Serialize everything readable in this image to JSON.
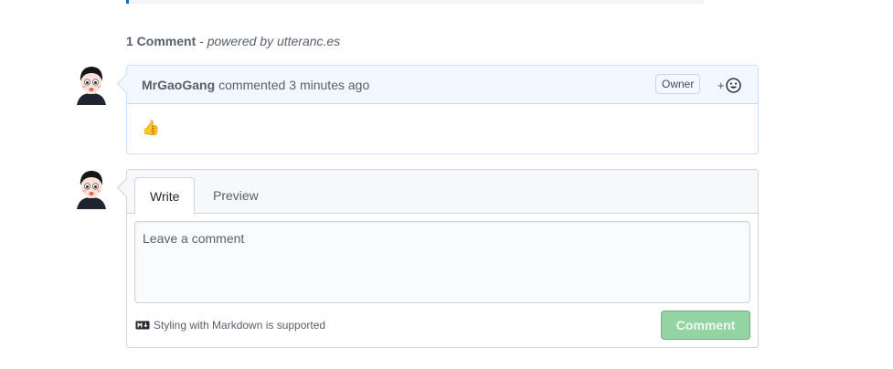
{
  "header": {
    "comment_count": "1 Comment",
    "separator": " - ",
    "powered_by": "powered by utteranc.es"
  },
  "comment": {
    "author": "MrGaoGang",
    "action": "commented",
    "time": "3 minutes ago",
    "badge": "Owner",
    "reaction_plus": "+",
    "reaction_icon": "smiley-icon",
    "body": "👍"
  },
  "editor": {
    "tabs": [
      {
        "label": "Write",
        "active": true
      },
      {
        "label": "Preview",
        "active": false
      }
    ],
    "placeholder": "Leave a comment",
    "markdown_note": "Styling with Markdown is supported",
    "submit_label": "Comment"
  },
  "colors": {
    "accent": "#0366d6",
    "header_bg": "#f1f8ff",
    "submit_disabled": "#94d3a2"
  }
}
